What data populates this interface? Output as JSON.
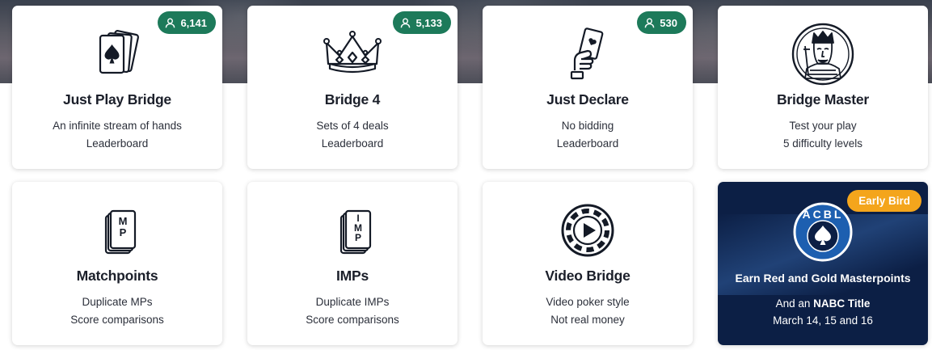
{
  "cards": [
    {
      "title": "Just Play Bridge",
      "line1": "An infinite stream of hands",
      "line2": "Leaderboard",
      "players": "6,141",
      "icon": "spade-cards-icon"
    },
    {
      "title": "Bridge 4",
      "line1": "Sets of 4 deals",
      "line2": "Leaderboard",
      "players": "5,133",
      "icon": "crown-icon"
    },
    {
      "title": "Just Declare",
      "line1": "No bidding",
      "line2": "Leaderboard",
      "players": "530",
      "icon": "hand-holding-card-icon"
    },
    {
      "title": "Bridge Master",
      "line1": "Test your play",
      "line2": "5 difficulty levels",
      "icon": "king-face-icon"
    },
    {
      "title": "Matchpoints",
      "line1": "Duplicate MPs",
      "line2": "Score comparisons",
      "icon": "mp-cards-icon",
      "icon_text": [
        "M",
        "P"
      ]
    },
    {
      "title": "IMPs",
      "line1": "Duplicate IMPs",
      "line2": "Score comparisons",
      "icon": "imp-cards-icon",
      "icon_text": [
        "I",
        "M",
        "P"
      ]
    },
    {
      "title": "Video Bridge",
      "line1": "Video poker style",
      "line2": "Not real money",
      "icon": "poker-chip-play-icon"
    }
  ],
  "promo": {
    "badge": "Early Bird",
    "logo_text": "ACBL",
    "title": "Earn Red and Gold Masterpoints",
    "line1_prefix": "And an ",
    "line1_bold": "NABC Title",
    "line2": "March 14, 15 and 16",
    "colors": {
      "background": "#0c1f45",
      "badge": "#f4a51c"
    }
  },
  "colors": {
    "player_badge": "#1d7a5a",
    "text": "#1b1f2a"
  }
}
